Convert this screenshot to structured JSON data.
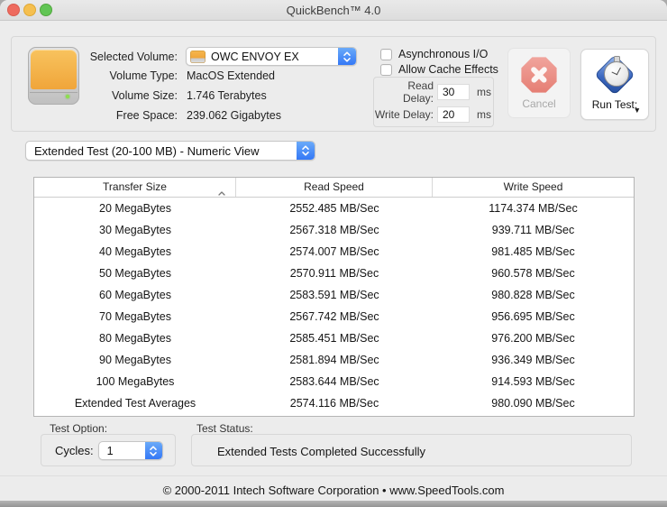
{
  "window": {
    "title": "QuickBench™ 4.0"
  },
  "volume": {
    "selected_label": "Selected Volume:",
    "selected_value": "OWC ENVOY EX",
    "details": [
      {
        "label": "Volume Type:",
        "value": "MacOS Extended"
      },
      {
        "label": "Volume Size:",
        "value": "1.746 Terabytes"
      },
      {
        "label": "Free Space:",
        "value": "239.062 Gigabytes"
      }
    ]
  },
  "io_options": {
    "checkboxes": [
      {
        "label": "Asynchronous I/O",
        "checked": false
      },
      {
        "label": "Allow Cache Effects",
        "checked": false
      }
    ],
    "read_delay": {
      "label": "Read Delay:",
      "value": "30",
      "unit": "ms"
    },
    "write_delay": {
      "label": "Write Delay:",
      "value": "20",
      "unit": "ms"
    }
  },
  "actions": {
    "cancel_label": "Cancel",
    "run_test_label": "Run Test:"
  },
  "test_selector_value": "Extended Test (20-100 MB) - Numeric View",
  "results": {
    "columns": [
      "Transfer Size",
      "Read Speed",
      "Write Speed"
    ],
    "sort": {
      "column": "Transfer Size",
      "direction": "asc"
    },
    "rows": [
      [
        "20 MegaBytes",
        "2552.485 MB/Sec",
        "1174.374 MB/Sec"
      ],
      [
        "30 MegaBytes",
        "2567.318 MB/Sec",
        "939.711 MB/Sec"
      ],
      [
        "40 MegaBytes",
        "2574.007 MB/Sec",
        "981.485 MB/Sec"
      ],
      [
        "50 MegaBytes",
        "2570.911 MB/Sec",
        "960.578 MB/Sec"
      ],
      [
        "60 MegaBytes",
        "2583.591 MB/Sec",
        "980.828 MB/Sec"
      ],
      [
        "70 MegaBytes",
        "2567.742 MB/Sec",
        "956.695 MB/Sec"
      ],
      [
        "80 MegaBytes",
        "2585.451 MB/Sec",
        "976.200 MB/Sec"
      ],
      [
        "90 MegaBytes",
        "2581.894 MB/Sec",
        "936.349 MB/Sec"
      ],
      [
        "100 MegaBytes",
        "2583.644 MB/Sec",
        "914.593 MB/Sec"
      ],
      [
        "Extended Test Averages",
        "2574.116 MB/Sec",
        "980.090 MB/Sec"
      ]
    ]
  },
  "test_option": {
    "title": "Test Option:",
    "cycles_label": "Cycles:",
    "cycles_value": "1"
  },
  "test_status": {
    "title": "Test Status:",
    "message": "Extended Tests Completed Successfully"
  },
  "footer_text": "© 2000-2011 Intech Software Corporation • www.SpeedTools.com",
  "colors": {
    "accent_blue": "#3478f6",
    "stop_red": "#e2695d",
    "drive_orange": "#f0a53a",
    "runtest_blue": "#3b67c0"
  }
}
